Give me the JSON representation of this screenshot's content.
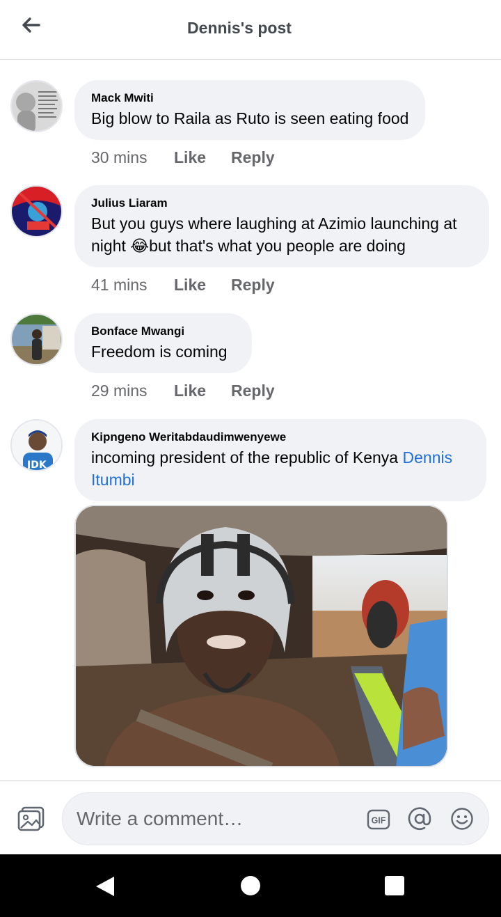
{
  "header": {
    "title": "Dennis's post",
    "back_icon": "arrow-left-icon"
  },
  "comments": [
    {
      "author": "Mack Mwiti",
      "text": "Big blow to Raila as Ruto is seen eating food",
      "time": "30 mins",
      "like": "Like",
      "reply": "Reply"
    },
    {
      "author": "Julius Liaram",
      "text_before": "But you guys where laughing at Azimio launching at night ",
      "emoji": "😂",
      "text_after": "but that's what you people are doing",
      "time": "41 mins",
      "like": "Like",
      "reply": "Reply"
    },
    {
      "author": "Bonface Mwangi",
      "text": "Freedom is coming",
      "time": "29 mins",
      "like": "Like",
      "reply": "Reply"
    },
    {
      "author": "Kipngeno Weritabdaudimwenyewe",
      "text": "incoming president of the republic of Kenya ",
      "mention": "Dennis Itumbi",
      "time": "",
      "like": "",
      "reply": ""
    }
  ],
  "composer": {
    "placeholder": "Write a comment…",
    "gif_label": "GIF"
  },
  "colors": {
    "accent": "#216fdb",
    "bubble": "#f0f2f5",
    "muted": "#65676b"
  }
}
